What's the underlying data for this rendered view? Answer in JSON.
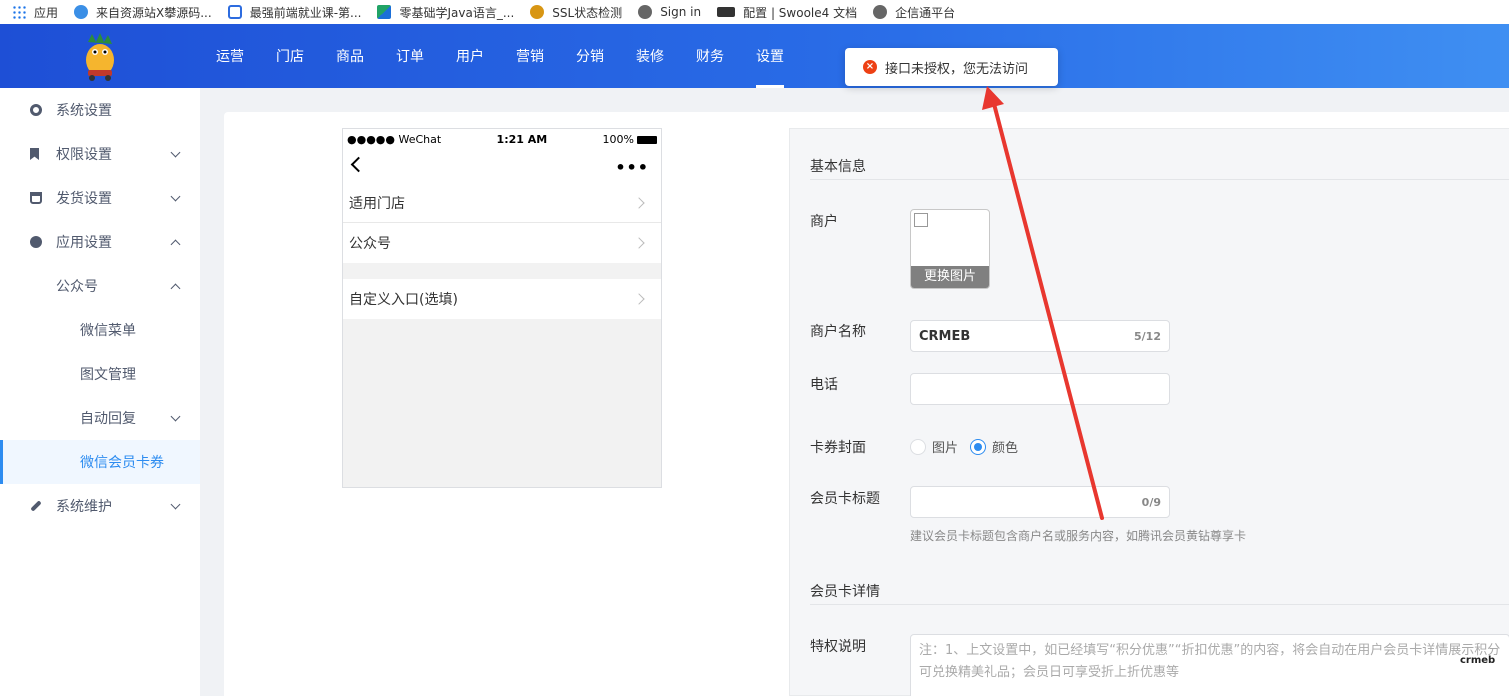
{
  "bookmarks": [
    {
      "label": "应用",
      "icon": "apps-grid-icon"
    },
    {
      "label": "来自资源站X攀源码...",
      "icon": "site-icon"
    },
    {
      "label": "最强前端就业课-第...",
      "icon": "bilibili-icon"
    },
    {
      "label": "零基础学Java语言_...",
      "icon": "book-icon"
    },
    {
      "label": "SSL状态检测",
      "icon": "medal-icon"
    },
    {
      "label": "Sign in",
      "icon": "globe-icon"
    },
    {
      "label": "配置 | Swoole4 文档",
      "icon": "swoole-icon"
    },
    {
      "label": "企信通平台",
      "icon": "globe-icon"
    }
  ],
  "topnav": [
    "运营",
    "门店",
    "商品",
    "订单",
    "用户",
    "营销",
    "分销",
    "装修",
    "财务",
    "设置"
  ],
  "toast": {
    "message": "接口未授权，您无法访问"
  },
  "sidebar": {
    "items": [
      {
        "label": "系统设置"
      },
      {
        "label": "权限设置"
      },
      {
        "label": "发货设置"
      },
      {
        "label": "应用设置"
      },
      {
        "label": "公众号"
      },
      {
        "label": "微信菜单"
      },
      {
        "label": "图文管理"
      },
      {
        "label": "自动回复"
      },
      {
        "label": "微信会员卡券"
      },
      {
        "label": "系统维护"
      }
    ]
  },
  "phone": {
    "carrier": "●●●●● WeChat",
    "time": "1:21 AM",
    "battery": "100%",
    "cells": [
      "适用门店",
      "公众号",
      "自定义入口(选填)"
    ]
  },
  "form": {
    "section_basic": "基本信息",
    "merchant_label": "商户",
    "change_image": "更换图片",
    "merchant_name_label": "商户名称",
    "merchant_name_value": "CRMEB",
    "merchant_name_count": "5/12",
    "phone_label": "电话",
    "phone_value": "",
    "cover_label": "卡券封面",
    "cover_options": [
      "图片",
      "颜色"
    ],
    "cover_selected": "颜色",
    "title_label": "会员卡标题",
    "title_value": "",
    "title_count": "0/9",
    "title_hint": "建议会员卡标题包含商户名或服务内容，如腾讯会员黄钻尊享卡",
    "section_detail": "会员卡详情",
    "privilege_label": "特权说明",
    "privilege_placeholder": "注：1、上文设置中，如已经填写“积分优惠”“折扣优惠”的内容，将会自动在用户会员卡详情展示积分可兑换精美礼品；会员日可享受折上折优惠等"
  },
  "corner_logo": "crmeb",
  "colors": {
    "header_start": "#1e4fd6",
    "header_end": "#3f8ff2",
    "accent": "#2d8cf0",
    "error": "#ed4014",
    "annotation": "#e8372f"
  }
}
